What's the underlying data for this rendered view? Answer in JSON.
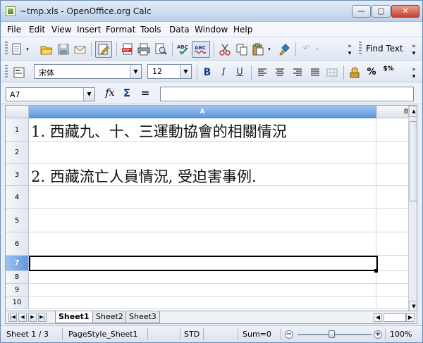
{
  "window": {
    "title": "~tmp.xls - OpenOffice.org Calc",
    "min_label": "—",
    "max_label": "▢",
    "close_label": "✕"
  },
  "menu": [
    {
      "label": "File"
    },
    {
      "label": "Edit"
    },
    {
      "label": "View"
    },
    {
      "label": "Insert"
    },
    {
      "label": "Format"
    },
    {
      "label": "Tools"
    },
    {
      "label": "Data"
    },
    {
      "label": "Window"
    },
    {
      "label": "Help"
    }
  ],
  "toolbar": {
    "find_text": "Find Text",
    "icons": [
      "new-icon",
      "open-icon",
      "save-icon",
      "email-icon",
      "edit-file-icon",
      "export-pdf-icon",
      "print-icon",
      "print-preview-icon",
      "spellcheck-icon",
      "autospellcheck-icon",
      "cut-icon",
      "copy-icon",
      "paste-icon",
      "format-paintbrush-icon",
      "undo-icon"
    ]
  },
  "formatting": {
    "font_name": "宋体",
    "font_size": "12",
    "bold": "B",
    "italic": "I",
    "underline": "U",
    "percent": "%",
    "currency": "$%"
  },
  "formula_bar": {
    "name_box": "A7",
    "function_wizard": "fx",
    "sum": "Σ",
    "equals": "=",
    "input": ""
  },
  "sheet": {
    "columns": [
      "A",
      "B"
    ],
    "rows": [
      {
        "num": "1",
        "A": "1. 西藏九、十、三運動協會的相關情況"
      },
      {
        "num": "2",
        "A": ""
      },
      {
        "num": "3",
        "A": "2. 西藏流亡人員情況, 受迫害事例."
      },
      {
        "num": "4",
        "A": ""
      },
      {
        "num": "5",
        "A": ""
      },
      {
        "num": "6",
        "A": ""
      },
      {
        "num": "7",
        "A": ""
      },
      {
        "num": "8",
        "A": ""
      },
      {
        "num": "9",
        "A": ""
      },
      {
        "num": "10",
        "A": ""
      }
    ],
    "selected_cell": "A7"
  },
  "tabs": [
    {
      "label": "Sheet1",
      "active": true
    },
    {
      "label": "Sheet2",
      "active": false
    },
    {
      "label": "Sheet3",
      "active": false
    }
  ],
  "status": {
    "sheet": "Sheet 1 / 3",
    "page_style": "PageStyle_Sheet1",
    "mode": "STD",
    "sum": "Sum=0",
    "zoom": "100%",
    "zoom_level": 1.0
  },
  "colors": {
    "selected_header": "#5f97df",
    "window_bg": "#e9eef6"
  }
}
